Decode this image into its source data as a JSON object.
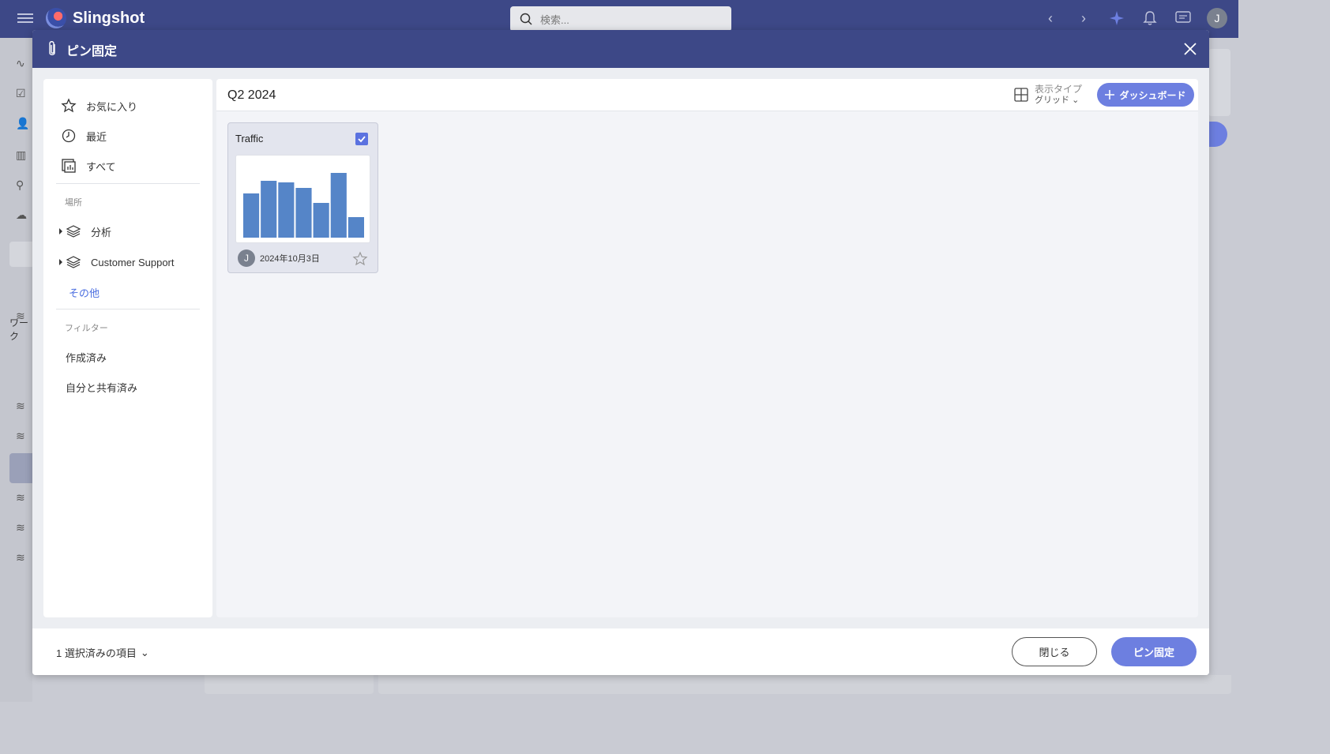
{
  "app": {
    "name": "Slingshot"
  },
  "search": {
    "placeholder": "検索..."
  },
  "rail": {
    "label": "ワーク"
  },
  "modal": {
    "title": "ピン固定",
    "sidebar": {
      "favorites": "お気に入り",
      "recent": "最近",
      "all": "すべて",
      "location_caption": "場所",
      "workspaces": [
        "分析",
        "Customer Support"
      ],
      "other": "その他",
      "filter_caption": "フィルター",
      "created": "作成済み",
      "shared_with_me": "自分と共有済み"
    },
    "main": {
      "title": "Q2 2024",
      "view_type_label": "表示タイプ",
      "view_type_value": "グリッド",
      "add_dashboard": "ダッシュボード"
    },
    "card": {
      "title": "Traffic",
      "date": "2024年10月3日",
      "owner_initial": "J",
      "checked": true
    },
    "footer": {
      "selected": "1 選択済みの項目",
      "close": "閉じる",
      "pin": "ピン固定"
    }
  },
  "user": {
    "initial": "J"
  },
  "colors": {
    "header": "#3d4887",
    "accent": "#6d7fe0",
    "bar": "#5585c8"
  },
  "chart_data": {
    "type": "bar",
    "values": [
      56,
      72,
      70,
      63,
      44,
      82,
      26
    ],
    "ylim": [
      0,
      90
    ]
  }
}
